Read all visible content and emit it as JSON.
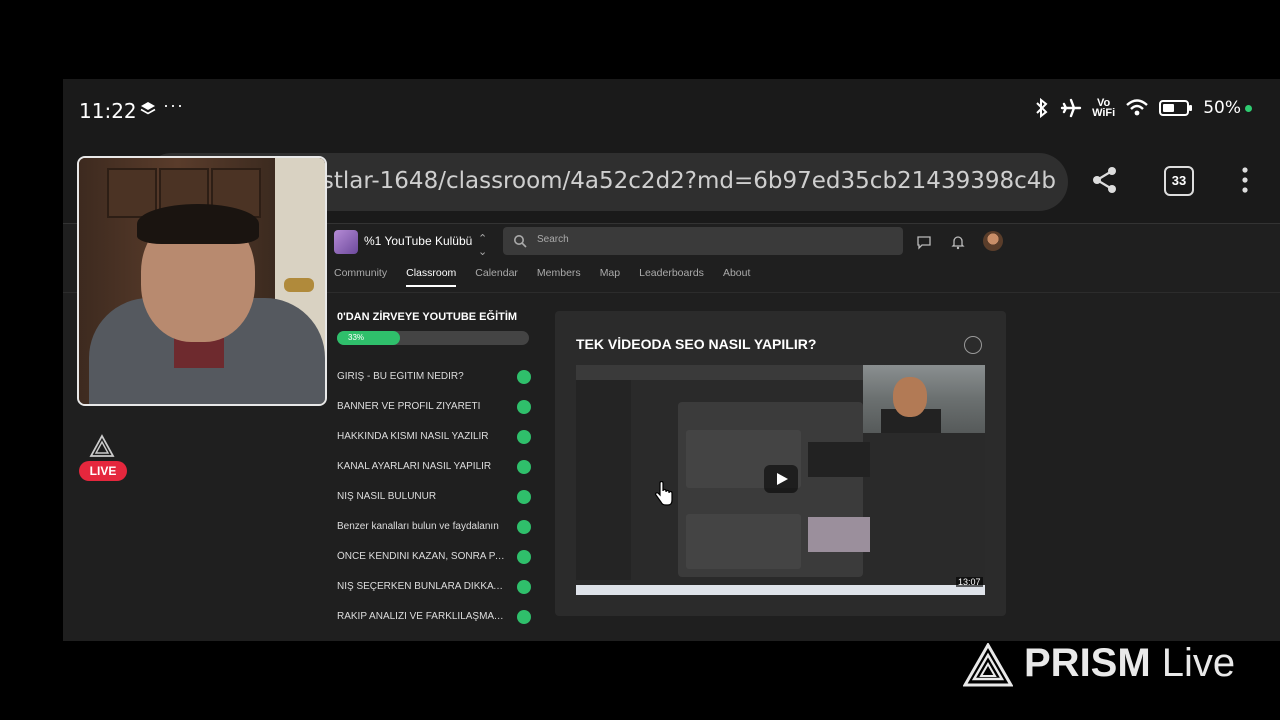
{
  "status_bar": {
    "time": "11:22",
    "more": "···",
    "vowifi_line1": "Vo",
    "vowifi_line2": "WiFi",
    "battery": "50%"
  },
  "browser": {
    "url": "an-ve-dostlar-1648/classroom/4a52c2d2?md=6b97ed35cb21439398c4b",
    "tab_count": "33"
  },
  "site": {
    "group_name": "%1 YouTube Kulübü",
    "search_placeholder": "Search",
    "tabs": [
      "Community",
      "Classroom",
      "Calendar",
      "Members",
      "Map",
      "Leaderboards",
      "About"
    ],
    "active_tab": "Classroom"
  },
  "course": {
    "title": "0'DAN ZİRVEYE YOUTUBE EĞİTİM",
    "progress_label": "33%",
    "progress_value": 0.33,
    "lessons": [
      "GİRİŞ - BU EĞİTİM NEDİR?",
      "BANNER VE PROFİL ZİYARETİ",
      "HAKKINDA KISMI NASIL YAZILIR",
      "KANAL AYARLARI NASIL YAPILIR",
      "NİŞ NASIL BULUNUR",
      "Benzer kanalları bulun ve faydalanın",
      "ÖNCE KENDİNİ KAZAN, SONRA PAR...",
      "NİŞ SEÇERKEN BUNLARA DİKKAT E...",
      "RAKİP ANALİZİ VE FARKLILAŞMA İL..."
    ]
  },
  "lesson_card": {
    "title": "TEK VİDEODA SEO NASIL YAPILIR?",
    "duration": "13:07"
  },
  "overlay": {
    "live_label": "LIVE",
    "watermark_bold": "PRISM",
    "watermark_light": " Live"
  },
  "colors": {
    "accent_green": "#2fbf6b",
    "live_red": "#e5273d"
  }
}
